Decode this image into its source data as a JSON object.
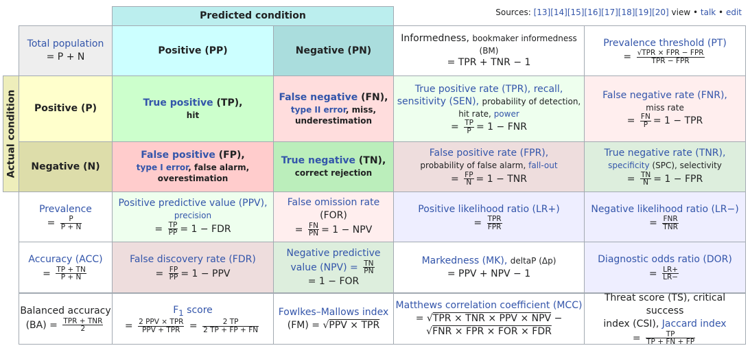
{
  "header": {
    "predicted_condition": "Predicted condition",
    "actual_condition": "Actual condition",
    "sources_label": "Sources:",
    "sources_refs": [
      "[13]",
      "[14]",
      "[15]",
      "[16]",
      "[17]",
      "[18]",
      "[19]",
      "[20]"
    ],
    "nav": {
      "view": "view",
      "talk": "talk",
      "edit": "edit",
      "sep": " • "
    }
  },
  "colors": {
    "predicted_header": "#bbeeee",
    "pred_positive": "#ccffff",
    "pred_negative": "#aadddd",
    "actual_header": "#eeeebb",
    "actual_positive": "#ffffcc",
    "actual_negative": "#ddddaa",
    "true_positive": "#ccffcc",
    "false_negative": "#ffdddd",
    "false_positive": "#ffcccc",
    "true_negative": "#bbeebb",
    "tpr": "#eeffee",
    "fnr": "#ffeeee",
    "fpr": "#eedddd",
    "tnr": "#ddeedd",
    "ppv": "#eeffee",
    "for": "#ffeeee",
    "fdr": "#eedddd",
    "npv": "#ddeedd",
    "lr": "#eeeeff",
    "link": "#3355aa"
  },
  "cells": {
    "total_population": {
      "label": "Total population",
      "formula": "= P + N"
    },
    "pred_positive": "Positive (PP)",
    "pred_negative": "Negative (PN)",
    "informedness": {
      "label": "Informedness,",
      "alt": "bookmaker informedness",
      "abbr": "(BM)",
      "formula": "= TPR + TNR − 1"
    },
    "prevalence_threshold": {
      "label": "Prevalence threshold",
      "abbr": "(PT)",
      "eq": "=",
      "num": "√TPR × FPR  − FPR",
      "den": "TPR − FPR"
    },
    "actual_positive": "Positive (P)",
    "actual_negative": "Negative (N)",
    "true_positive": {
      "label": "True positive",
      "abbr": "(TP),",
      "alt": "hit"
    },
    "false_negative": {
      "label": "False negative",
      "abbr": "(FN),",
      "alt_link": "type II error",
      "alt": ", miss,",
      "alt2": "underestimation"
    },
    "false_positive": {
      "label": "False positive",
      "abbr": "(FP),",
      "alt_link": "type I error",
      "alt": ", false alarm,",
      "alt2": "overestimation"
    },
    "true_negative": {
      "label": "True negative",
      "abbr": "(TN),",
      "alt": "correct rejection"
    },
    "tpr": {
      "label": "True positive rate (TPR), recall,",
      "label2": "sensitivity (SEN),",
      "alt": "probability of detection,",
      "alt2": "hit rate,",
      "alt2_link": "power",
      "num": "TP",
      "den": "P",
      "rest": "= 1 − FNR"
    },
    "fnr": {
      "label": "False negative rate (FNR),",
      "alt": "miss rate",
      "num": "FN",
      "den": "P",
      "rest": "= 1 − TPR"
    },
    "fpr": {
      "label": "False positive rate (FPR),",
      "alt": "probability of false alarm,",
      "alt_link": "fall-out",
      "num": "FP",
      "den": "N",
      "rest": "= 1 − TNR"
    },
    "tnr": {
      "label": "True negative rate (TNR),",
      "alt_link": "specificity",
      "alt": "(SPC), selectivity",
      "num": "TN",
      "den": "N",
      "rest": "= 1 − FPR"
    },
    "prevalence": {
      "label": "Prevalence",
      "num": "P",
      "den": "P + N"
    },
    "ppv": {
      "label": "Positive predictive value (PPV),",
      "alt": "precision",
      "num": "TP",
      "den": "PP",
      "rest": "= 1 − FDR"
    },
    "for": {
      "label": "False omission rate",
      "abbr": "(FOR)",
      "num": "FN",
      "den": "PN",
      "rest": "= 1 − NPV"
    },
    "lr_pos": {
      "label": "Positive likelihood ratio (LR+)",
      "num": "TPR",
      "den": "FPR"
    },
    "lr_neg": {
      "label": "Negative likelihood ratio (LR−)",
      "num": "FNR",
      "den": "TNR"
    },
    "accuracy": {
      "label": "Accuracy",
      "abbr": "(ACC)",
      "num": "TP + TN",
      "den": "P + N"
    },
    "fdr": {
      "label": "False discovery rate (FDR)",
      "num": "FP",
      "den": "PP",
      "rest": "= 1 − PPV"
    },
    "npv": {
      "label": "Negative predictive",
      "label2": "value (NPV) =",
      "num": "TN",
      "den": "PN",
      "rest": "= 1 − FOR"
    },
    "markedness": {
      "label": "Markedness",
      "abbr": "(MK),",
      "alt": "deltaP (Δp)",
      "formula": "= PPV + NPV − 1"
    },
    "dor": {
      "label": "Diagnostic odds ratio (DOR)",
      "num": "LR+",
      "den": "LR−"
    },
    "balanced_accuracy": {
      "label": "Balanced accuracy",
      "prefix": "(BA) =",
      "num": "TPR + TNR",
      "den": "2"
    },
    "f1": {
      "label": "F",
      "sub": "1",
      "label_rest": " score",
      "num1": "2 PPV × TPR",
      "den1": "PPV + TPR",
      "num2": "2 TP",
      "den2": "2 TP + FP + FN"
    },
    "fm": {
      "label": "Fowlkes–Mallows index",
      "prefix": "(FM) = √",
      "radicand": "PPV × TPR"
    },
    "mcc": {
      "label": "Matthews correlation coefficient",
      "abbr": "(MCC)",
      "line1_prefix": "= √",
      "line1": "TPR × TNR × PPV × NPV",
      "line1_suffix": " −",
      "line2_prefix": "√",
      "line2": "FNR × FPR × FOR × FDR"
    },
    "threat_score": {
      "label": "Threat score (TS), critical success",
      "label2": "index (CSI),",
      "link": "Jaccard index",
      "num": "TP",
      "den": "TP + FN + FP"
    }
  }
}
